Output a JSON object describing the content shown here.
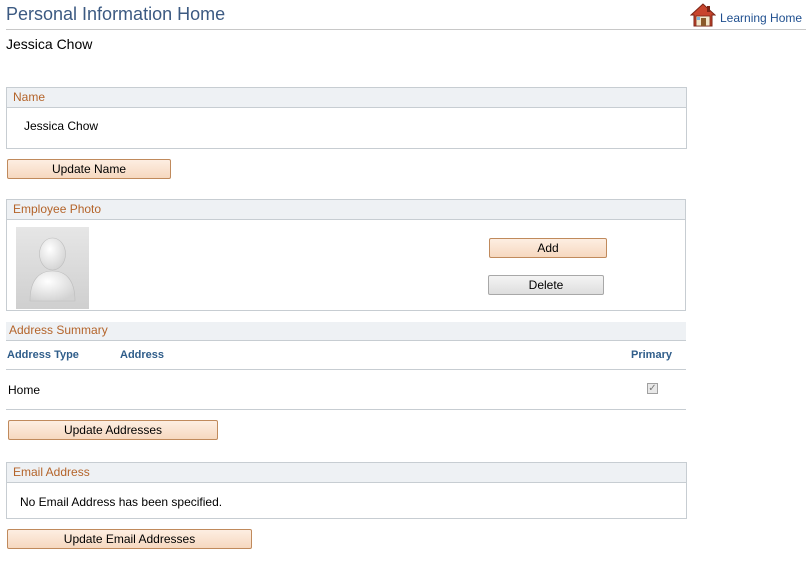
{
  "header": {
    "title": "Personal Information Home",
    "home_link": "Learning Home",
    "employee_name": "Jessica Chow"
  },
  "name_section": {
    "heading": "Name",
    "value": "Jessica Chow",
    "update_button": "Update Name"
  },
  "photo_section": {
    "heading": "Employee Photo",
    "add_button": "Add",
    "delete_button": "Delete"
  },
  "address_section": {
    "heading": "Address Summary",
    "columns": [
      "Address Type",
      "Address",
      "Primary"
    ],
    "rows": [
      {
        "type": "Home",
        "address": "",
        "primary": true
      }
    ],
    "update_button": "Update Addresses"
  },
  "email_section": {
    "heading": "Email Address",
    "message": "No Email Address has been specified.",
    "update_button": "Update Email Addresses"
  },
  "icons": {
    "home": "house-icon",
    "photo": "person-silhouette-icon",
    "checkbox": "checkmark-icon"
  },
  "colors": {
    "title": "#3c5a82",
    "section_heading": "#b4642a",
    "column_heading": "#2f5d8a",
    "button_fill": "#f6d8bf"
  }
}
